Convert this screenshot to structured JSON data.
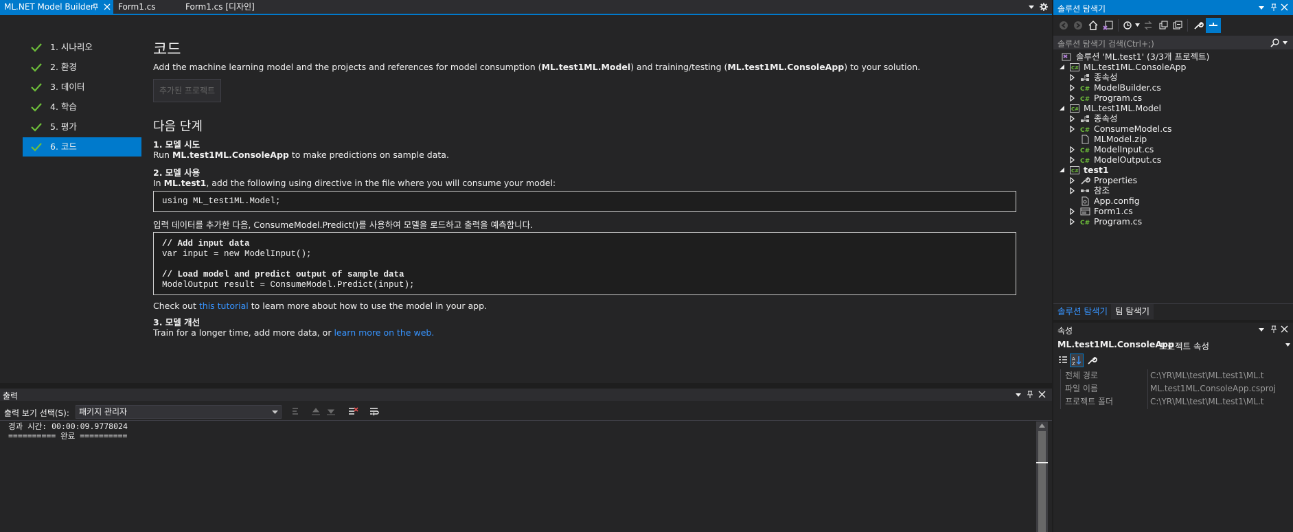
{
  "tabs": [
    {
      "label": "ML.NET Model Builder",
      "active": true
    },
    {
      "label": "Form1.cs",
      "active": false
    },
    {
      "label": "Form1.cs [디자인]",
      "active": false
    }
  ],
  "builder": {
    "steps": [
      {
        "label": "1. 시나리오"
      },
      {
        "label": "2. 환경"
      },
      {
        "label": "3. 데이터"
      },
      {
        "label": "4. 학습"
      },
      {
        "label": "5. 평가"
      },
      {
        "label": "6. 코드",
        "selected": true
      }
    ],
    "title": "코드",
    "intro": {
      "p1": "Add the machine learning model and the projects and references for model consumption (",
      "b1": "ML.test1ML.Model",
      "p2": ") and training/testing (",
      "b2": "ML.test1ML.ConsoleApp",
      "p3": ") to your solution."
    },
    "added_projects_button": "추가된 프로젝트",
    "next_steps_title": "다음 단계",
    "s1_heading": "1. 모델 시도",
    "s1_run": "Run ",
    "s1_bold": "ML.test1ML.ConsoleApp",
    "s1_rest": " to make predictions on sample data.",
    "s2_heading": "2. 모델 사용",
    "s2_in": "In ",
    "s2_bold": "ML.test1",
    "s2_rest": ", add the following using directive in the file where you will consume your model:",
    "using_code": "using ML_test1ML.Model;",
    "s2_note": "입력 데이터를 추가한 다음, ConsumeModel.Predict()를 사용하여 모델을 로드하고 출력을 예측합니다.",
    "code_lines": [
      "// Add input data",
      "var input = new ModelInput();",
      "// Load model and predict output of sample data",
      "ModelOutput result = ConsumeModel.Predict(input);"
    ],
    "checkout_pre": "Check out ",
    "checkout_link": "this tutorial",
    "checkout_post": " to learn more about how to use the model in your app.",
    "s3_heading": "3. 모델 개선",
    "s3_pre": " Train for a longer time, add more data, or ",
    "s3_link": "learn more on the web."
  },
  "output": {
    "title": "출력",
    "show_from_label": "출력 보기 선택(S):",
    "show_from_value": "패키지 관리자",
    "lines": [
      "경과 시간: 00:00:09.9778024",
      "========== 완료 =========="
    ]
  },
  "solution": {
    "title": "솔루션 탐색기",
    "search_placeholder": "솔루션 탐색기 검색(Ctrl+;)",
    "solution_label": "솔루션 'ML.test1' (3/3개 프로젝트)",
    "tree": [
      {
        "label": "ML.test1ML.ConsoleApp",
        "type": "project",
        "level": 1,
        "arrow": "open",
        "bold": false
      },
      {
        "label": "종속성",
        "type": "deps",
        "level": 2,
        "arrow": "closed"
      },
      {
        "label": "ModelBuilder.cs",
        "type": "cs",
        "level": 2,
        "arrow": "closed"
      },
      {
        "label": "Program.cs",
        "type": "cs",
        "level": 2,
        "arrow": "closed"
      },
      {
        "label": "ML.test1ML.Model",
        "type": "project",
        "level": 1,
        "arrow": "open"
      },
      {
        "label": "종속성",
        "type": "deps",
        "level": 2,
        "arrow": "closed"
      },
      {
        "label": "ConsumeModel.cs",
        "type": "cs",
        "level": 2,
        "arrow": "closed"
      },
      {
        "label": "MLModel.zip",
        "type": "file",
        "level": 2,
        "arrow": "none"
      },
      {
        "label": "ModelInput.cs",
        "type": "cs",
        "level": 2,
        "arrow": "closed"
      },
      {
        "label": "ModelOutput.cs",
        "type": "cs",
        "level": 2,
        "arrow": "closed"
      },
      {
        "label": "test1",
        "type": "project",
        "level": 1,
        "arrow": "open",
        "bold": true
      },
      {
        "label": "Properties",
        "type": "wrench",
        "level": 2,
        "arrow": "closed"
      },
      {
        "label": "참조",
        "type": "refs",
        "level": 2,
        "arrow": "closed"
      },
      {
        "label": "App.config",
        "type": "config",
        "level": 2,
        "arrow": "none"
      },
      {
        "label": "Form1.cs",
        "type": "form",
        "level": 2,
        "arrow": "closed"
      },
      {
        "label": "Program.cs",
        "type": "cs",
        "level": 2,
        "arrow": "closed"
      }
    ],
    "bottom_tabs": [
      "솔루션 탐색기",
      "팀 탐색기"
    ]
  },
  "properties": {
    "title": "속성",
    "object_name": "ML.test1ML.ConsoleApp",
    "object_type": "프로젝트 속성",
    "rows": [
      {
        "name": "전체 경로",
        "value": "C:\\YR\\ML\\test\\ML.test1\\ML.t"
      },
      {
        "name": "파일 이름",
        "value": "ML.test1ML.ConsoleApp.csproj"
      },
      {
        "name": "프로젝트 폴더",
        "value": "C:\\YR\\ML\\test\\ML.test1\\ML.t"
      }
    ]
  },
  "colors": {
    "accent": "#007acc",
    "link": "#3794ff",
    "check": "#6ebf3a",
    "background": "#1e1e1e",
    "panel": "#252526"
  }
}
